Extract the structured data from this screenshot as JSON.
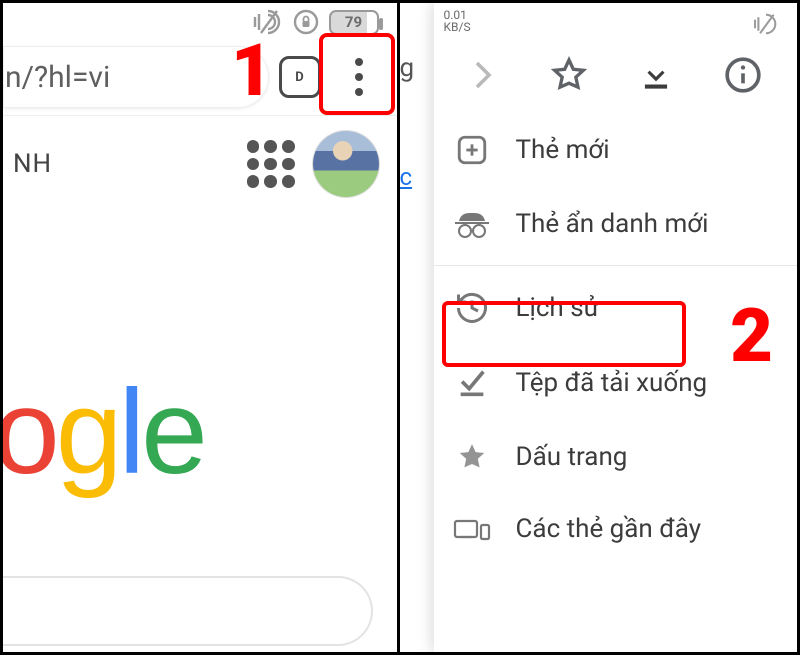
{
  "left": {
    "status": {
      "battery": "79"
    },
    "url": "n/?hl=vi",
    "tabs_badge": "D",
    "tab_label": "NH",
    "logo_chars": [
      "o",
      "g",
      "l",
      "e"
    ],
    "annotation": "1"
  },
  "right": {
    "status_kbs_top": "0.01",
    "status_kbs_bottom": "KB/S",
    "sliver_g": "g",
    "sliver_c": "c",
    "menu": {
      "new_tab": "Thẻ mới",
      "incognito": "Thẻ ẩn danh mới",
      "history": "Lịch sử",
      "downloads": "Tệp đã tải xuống",
      "bookmarks": "Dấu trang",
      "recent": "Các thẻ gần đây"
    },
    "annotation": "2"
  }
}
